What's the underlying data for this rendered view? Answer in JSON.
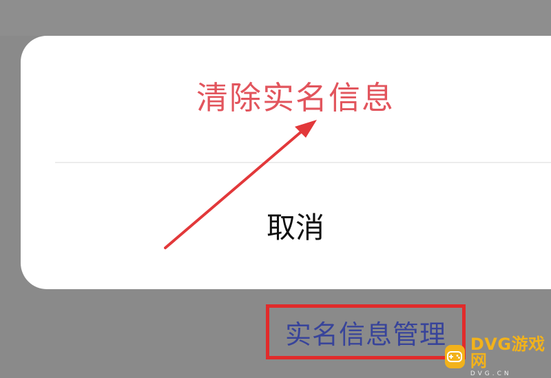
{
  "sheet": {
    "clear_label": "清除实名信息",
    "cancel_label": "取消"
  },
  "menu": {
    "entry_label": "实名信息管理"
  },
  "watermark": {
    "brand": "DVG游戏网",
    "domain": "DVG.CN"
  },
  "colors": {
    "clear_text": "#e2555d",
    "highlight_box": "#e12b2b",
    "entry_text": "#38449a",
    "watermark": "#f2b21b"
  }
}
